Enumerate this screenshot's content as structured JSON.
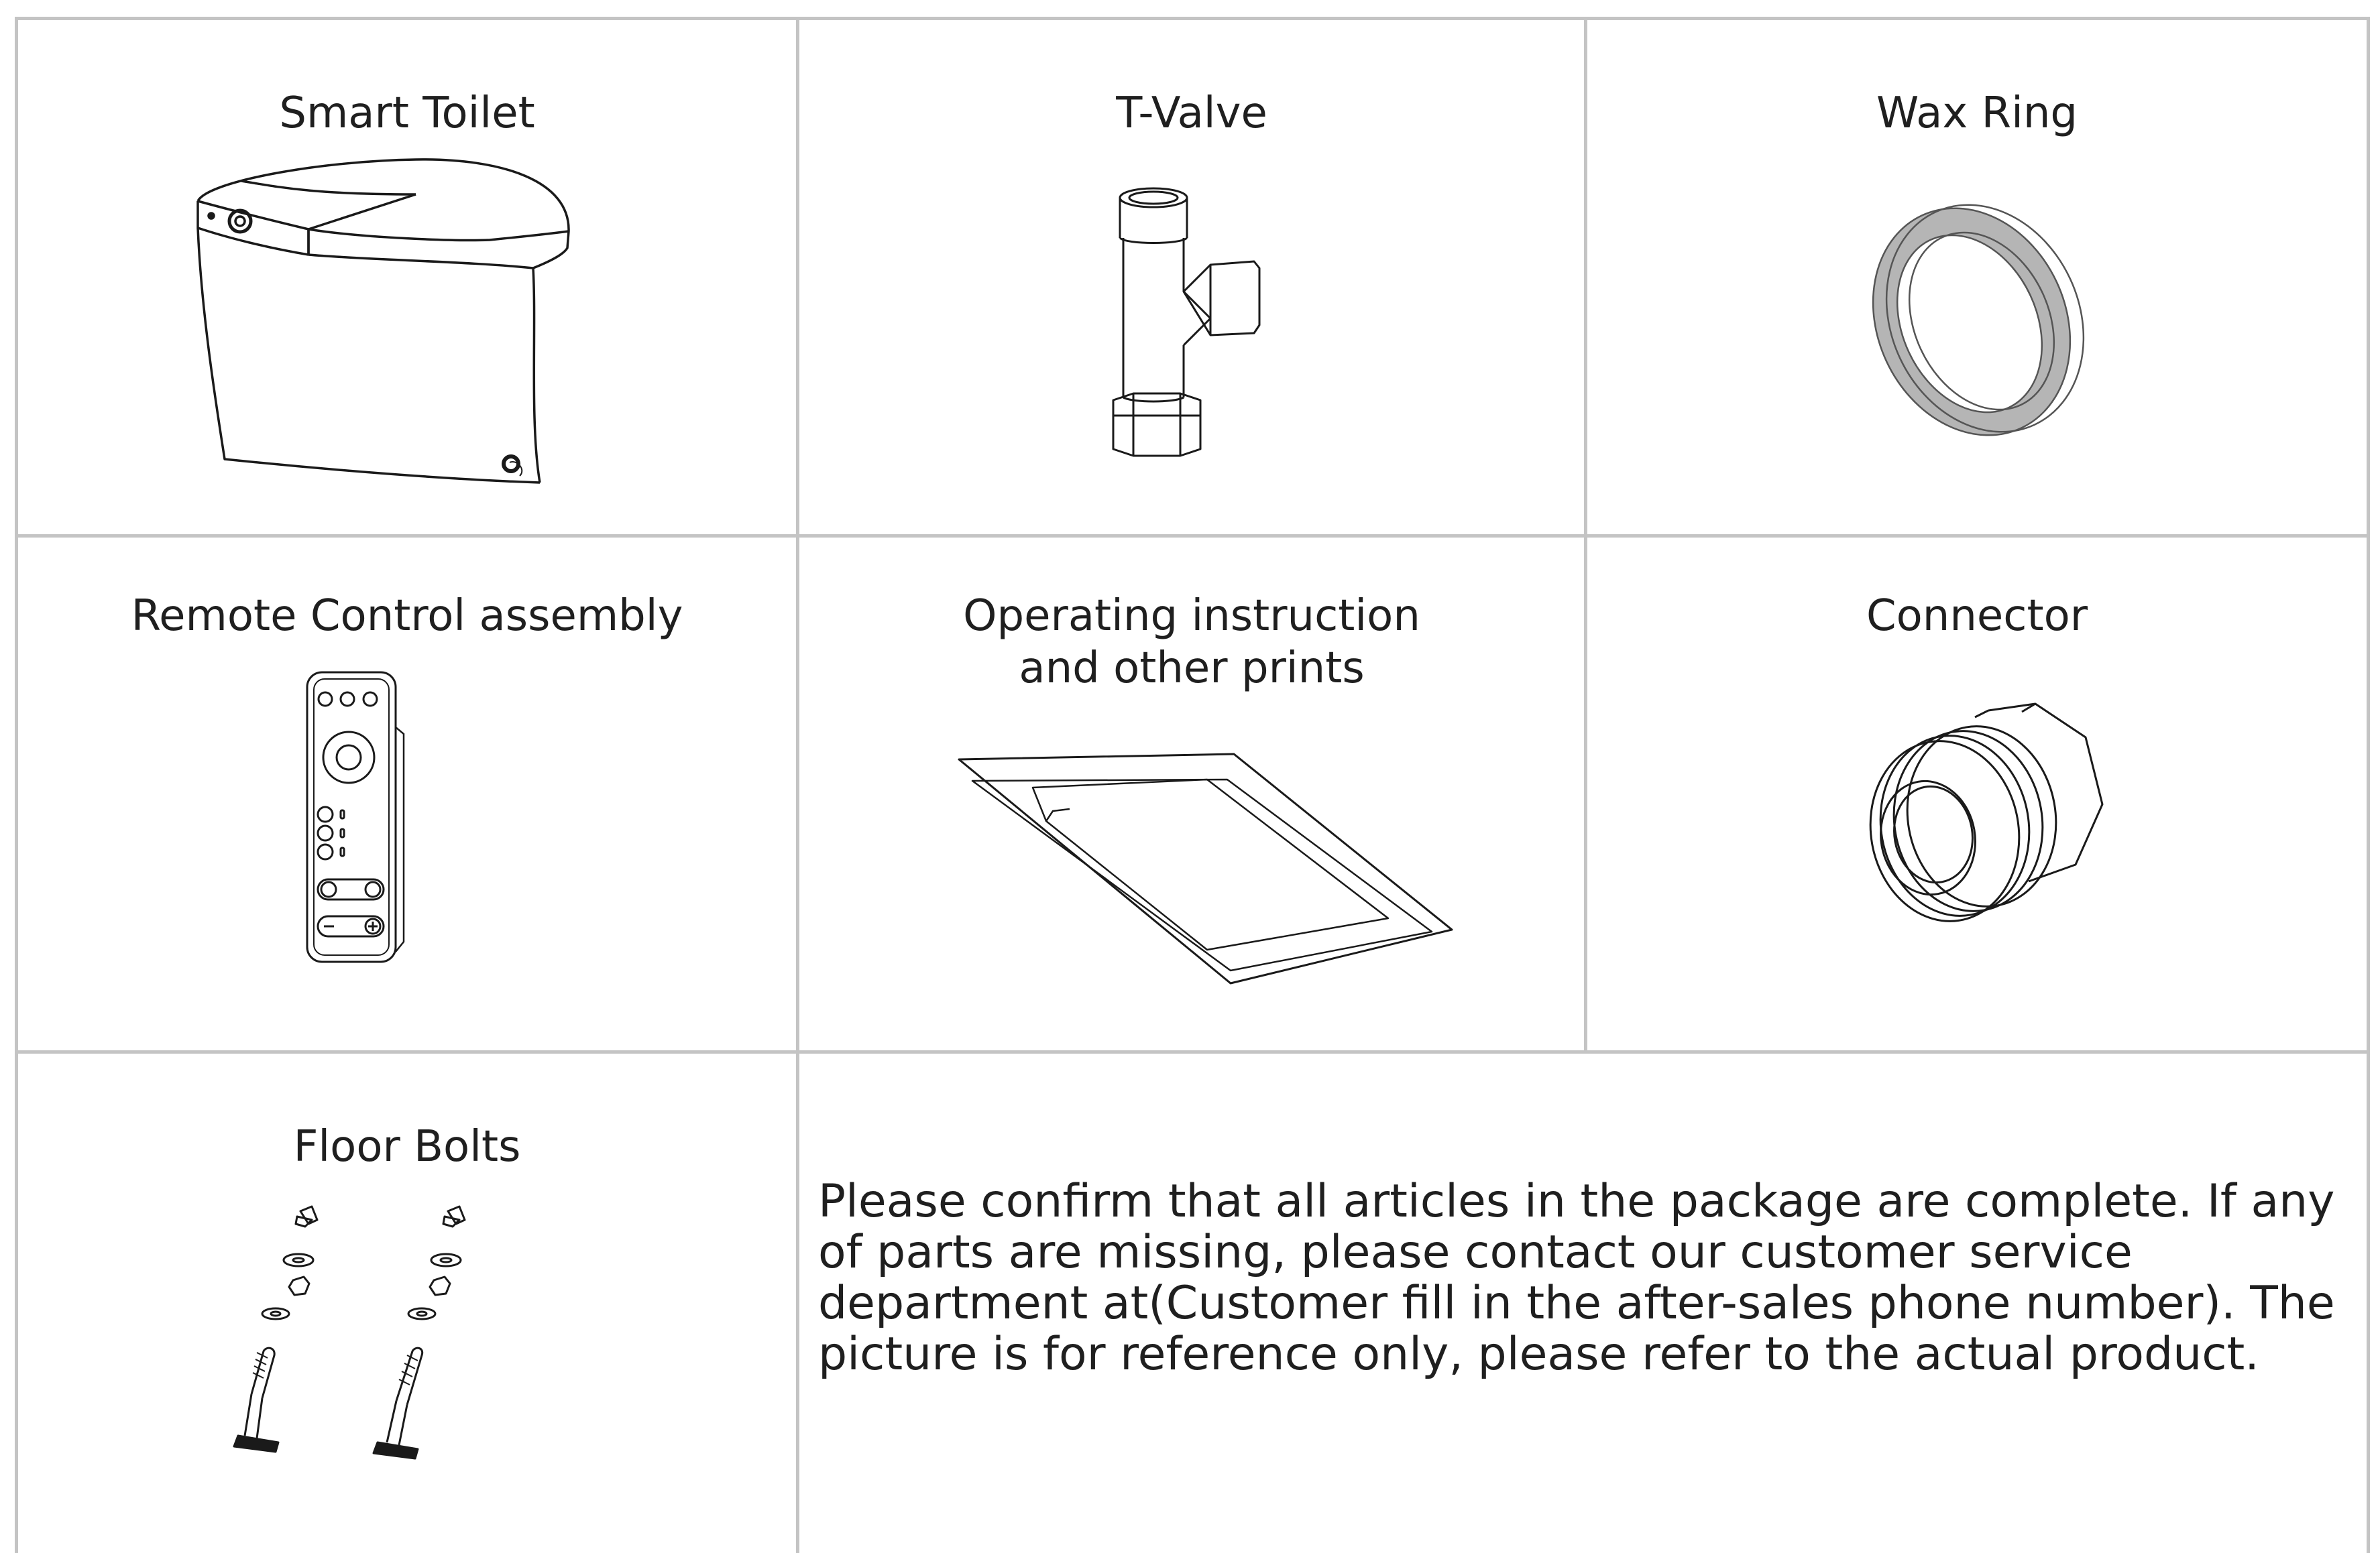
{
  "items": [
    {
      "label": "Smart Toilet",
      "icon": "smart-toilet-icon"
    },
    {
      "label": "T-Valve",
      "icon": "t-valve-icon"
    },
    {
      "label": "Wax Ring",
      "icon": "wax-ring-icon"
    },
    {
      "label": "Remote Control assembly",
      "icon": "remote-control-icon"
    },
    {
      "label": "Operating instruction\nand other prints",
      "icon": "manual-prints-icon"
    },
    {
      "label": "Connector",
      "icon": "connector-icon"
    },
    {
      "label": "Floor Bolts",
      "icon": "floor-bolts-icon"
    }
  ],
  "note": "Please confirm that all articles in the package are complete. If any of parts are missing, please contact our customer service department at(Customer fill in the after-sales phone number). The picture is for reference only, please refer to the actual product."
}
